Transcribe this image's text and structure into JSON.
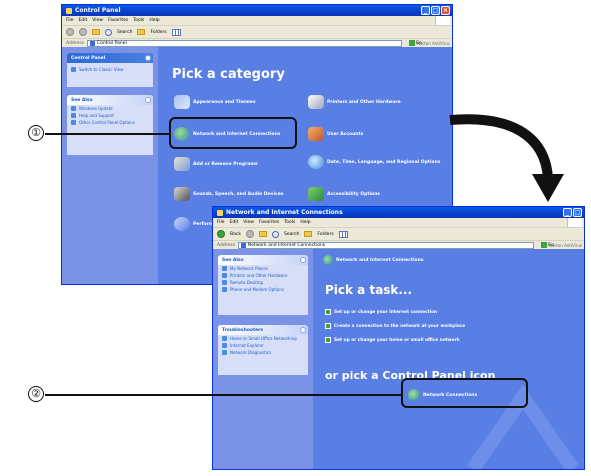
{
  "callouts": {
    "one": "①",
    "two": "②"
  },
  "menu_items": [
    "File",
    "Edit",
    "View",
    "Favorites",
    "Tools",
    "Help"
  ],
  "toolbar": {
    "back": "Back",
    "search": "Search",
    "folders": "Folders"
  },
  "address_label": "Address",
  "go_label": "Go",
  "norton_label": "Norton AntiVirus",
  "window1": {
    "title": "Control Panel",
    "address": "Control Panel",
    "side": {
      "panel_title": "Control Panel",
      "switch_view": "Switch to Classic View",
      "see_also_title": "See Also",
      "see_also": [
        "Windows Update",
        "Help and Support",
        "Other Control Panel Options"
      ]
    },
    "heading": "Pick a category",
    "categories": [
      "Appearance and Themes",
      "Printers and Other Hardware",
      "Network and Internet Connections",
      "User Accounts",
      "Add or Remove Programs",
      "Date, Time, Language, and Regional Options",
      "Sounds, Speech, and Audio Devices",
      "Accessibility Options",
      "Performance and Maintenance"
    ]
  },
  "window2": {
    "title": "Network and Internet Connections",
    "address": "Network and Internet Connections",
    "section_title": "Network and Internet Connections",
    "see_also_title": "See Also",
    "see_also": [
      "My Network Places",
      "Printers and Other Hardware",
      "Remote Desktop",
      "Phone and Modem Options"
    ],
    "troubleshooters_title": "Troubleshooters",
    "troubleshooters": [
      "Home or Small Office Networking",
      "Internet Explorer",
      "Network Diagnostics"
    ],
    "pick_task": "Pick a task...",
    "tasks": [
      "Set up or change your Internet connection",
      "Create a connection to the network at your workplace",
      "Set up or change your home or small office network"
    ],
    "pick_icon": "or pick a Control Panel icon",
    "icon_item": "Network Connections"
  },
  "colors": {
    "xp_blue": "#5a7fe4",
    "title_blue": "#0b3fce",
    "highlight": "#111111"
  }
}
